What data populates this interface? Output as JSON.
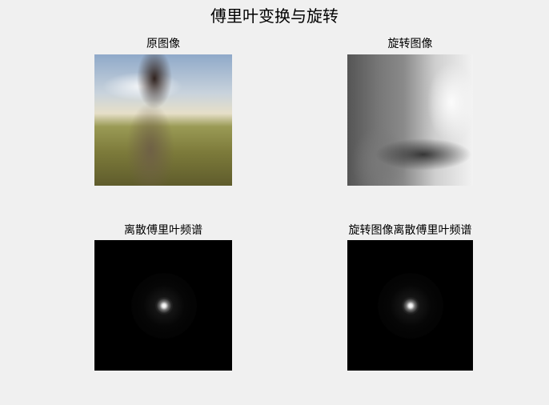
{
  "figure": {
    "title": "傅里叶变换与旋转"
  },
  "panels": [
    {
      "title": "原图像"
    },
    {
      "title": "旋转图像"
    },
    {
      "title": "离散傅里叶频谱"
    },
    {
      "title": "旋转图像离散傅里叶频谱"
    }
  ]
}
